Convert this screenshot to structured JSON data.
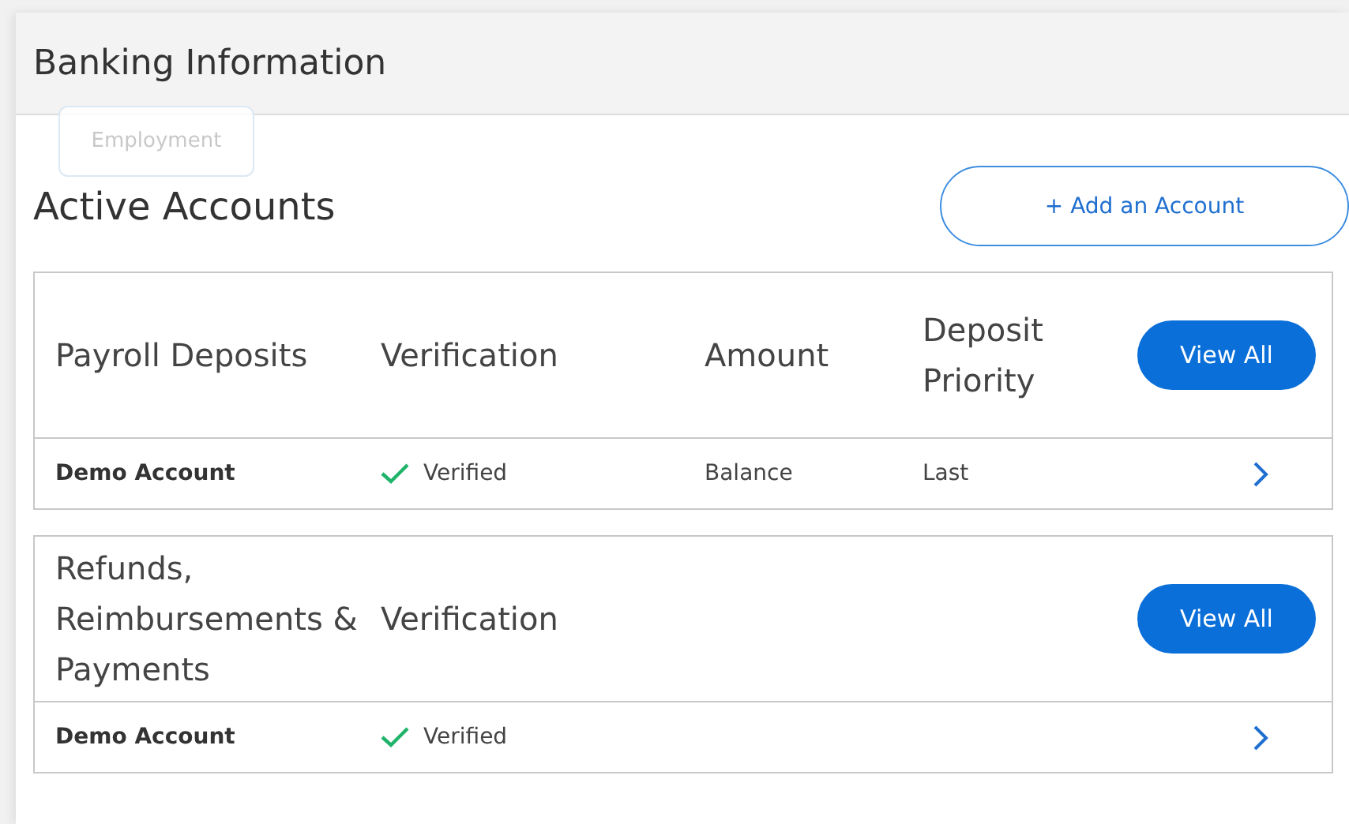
{
  "header": {
    "title": "Banking Information"
  },
  "tooltip": {
    "text": "Employment"
  },
  "heading": "Active Accounts",
  "add_button": "+ Add an Account",
  "sections": [
    {
      "columns": [
        "Payroll Deposits",
        "Verification",
        "Amount",
        "Deposit Priority"
      ],
      "button": "View All",
      "rows": [
        {
          "name": "Demo Account",
          "verification": "Verified",
          "verified": true,
          "amount": "Balance",
          "priority": "Last"
        }
      ]
    },
    {
      "columns": [
        "Refunds, Reimbursements & Payments",
        "Verification"
      ],
      "button": "View All",
      "rows": [
        {
          "name": "Demo Account",
          "verification": "Verified",
          "verified": true
        }
      ]
    }
  ]
}
